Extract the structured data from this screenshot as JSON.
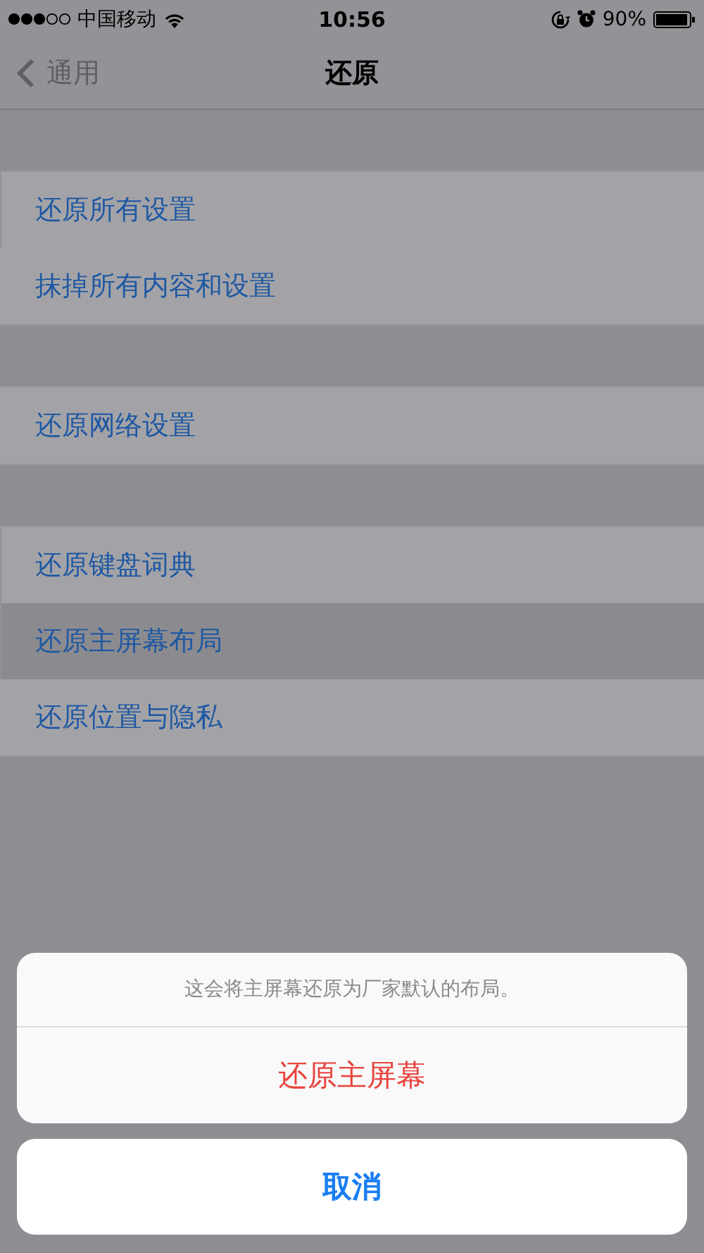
{
  "status_bar": {
    "carrier": "中国移动",
    "time": "10:56",
    "battery": "90%"
  },
  "nav_bar": {
    "back": "通用",
    "title": "还原"
  },
  "groups": [
    {
      "items": [
        {
          "label": "还原所有设置",
          "selected": false
        },
        {
          "label": "抹掉所有内容和设置",
          "selected": false
        }
      ]
    },
    {
      "items": [
        {
          "label": "还原网络设置",
          "selected": false
        }
      ]
    },
    {
      "items": [
        {
          "label": "还原键盘词典",
          "selected": false
        },
        {
          "label": "还原主屏幕布局",
          "selected": true
        },
        {
          "label": "还原位置与隐私",
          "selected": false
        }
      ]
    }
  ],
  "action_sheet": {
    "message": "这会将主屏幕还原为厂家默认的布局。",
    "actions": [
      {
        "label": "还原主屏幕",
        "kind": "destructive"
      }
    ],
    "cancel": "取消"
  }
}
